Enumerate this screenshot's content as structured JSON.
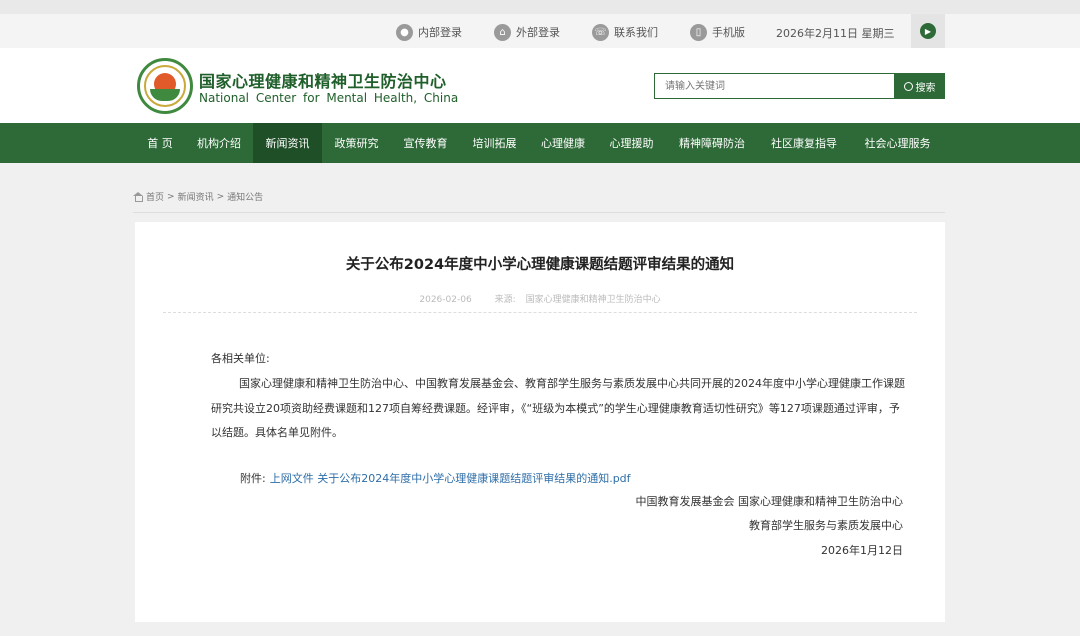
{
  "topbar": {
    "items": [
      {
        "label": "内部登录",
        "icon": "user-icon"
      },
      {
        "label": "外部登录",
        "icon": "home-icon"
      },
      {
        "label": "联系我们",
        "icon": "phone-icon"
      },
      {
        "label": "手机版",
        "icon": "mobile-icon"
      }
    ],
    "date": "2026年2月11日 星期三"
  },
  "header": {
    "site_name_cn": "国家心理健康和精神卫生防治中心",
    "site_name_en": "National Center for Mental Health, China",
    "search_placeholder": "请输入关键词",
    "search_button": "搜索"
  },
  "nav": {
    "items": [
      "首 页",
      "机构介绍",
      "新闻资讯",
      "政策研究",
      "宣传教育",
      "培训拓展",
      "心理健康",
      "心理援助",
      "精神障碍防治",
      "社区康复指导",
      "社会心理服务"
    ],
    "active_index": 2
  },
  "breadcrumb": {
    "home": "首页",
    "sep": ">",
    "level1": "新闻资讯",
    "level2": "通知公告"
  },
  "article": {
    "title": "关于公布2024年度中小学心理健康课题结题评审结果的通知",
    "date": "2026-02-06",
    "source_label": "来源:",
    "source": "国家心理健康和精神卫生防治中心",
    "greeting": "各相关单位:",
    "body": "国家心理健康和精神卫生防治中心、中国教育发展基金会、教育部学生服务与素质发展中心共同开展的2024年度中小学心理健康工作课题研究共设立20项资助经费课题和127项自筹经费课题。经评审，《“班级为本模式”的学生心理健康教育适切性研究》等127项课题通过评审，予以结题。具体名单见附件。",
    "attachment_label": "附件:",
    "attachment_link": "上网文件 关于公布2024年度中小学心理健康课题结题评审结果的通知.pdf",
    "signature_line1": "中国教育发展基金会 国家心理健康和精神卫生防治中心",
    "signature_line2": "教育部学生服务与素质发展中心",
    "signature_date": "2026年1月12日"
  },
  "colors": {
    "brand_green": "#2d6a37",
    "nav_active": "#1f4f27",
    "link_blue": "#2f6ea8"
  }
}
